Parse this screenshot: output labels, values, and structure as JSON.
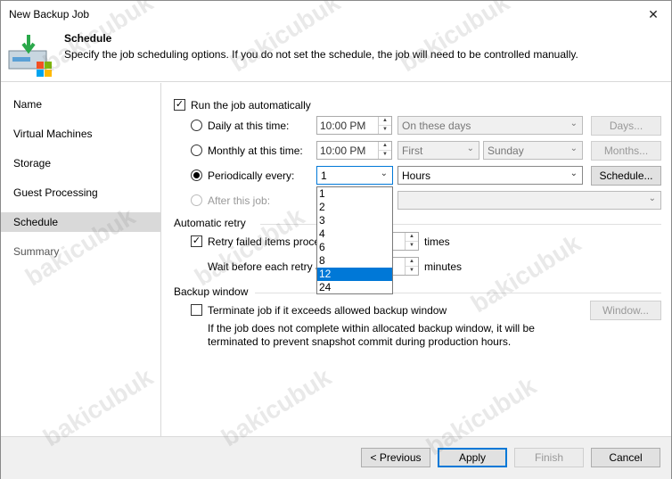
{
  "window": {
    "title": "New Backup Job",
    "close_icon": "close-icon"
  },
  "header": {
    "title": "Schedule",
    "description": "Specify the job scheduling options. If you do not set the schedule, the job will need to be controlled manually."
  },
  "sidebar": {
    "items": [
      {
        "label": "Name"
      },
      {
        "label": "Virtual Machines"
      },
      {
        "label": "Storage"
      },
      {
        "label": "Guest Processing"
      },
      {
        "label": "Schedule"
      },
      {
        "label": "Summary"
      }
    ],
    "active_index": 4
  },
  "schedule": {
    "run_automatically": {
      "label": "Run the job automatically",
      "checked": true
    },
    "daily": {
      "label": "Daily at this time:",
      "time": "10:00 PM",
      "days_combo": "On these days",
      "days_button": "Days..."
    },
    "monthly": {
      "label": "Monthly at this time:",
      "time": "10:00 PM",
      "week_combo": "First",
      "day_combo": "Sunday",
      "months_button": "Months..."
    },
    "periodically": {
      "label": "Periodically every:",
      "value": "1",
      "unit": "Hours",
      "schedule_button": "Schedule..."
    },
    "after_job": {
      "label": "After this job:"
    },
    "dropdown_options": [
      "1",
      "2",
      "3",
      "4",
      "6",
      "8",
      "12",
      "24"
    ],
    "dropdown_highlighted": "12"
  },
  "retry": {
    "section_title": "Automatic retry",
    "retry_label": "Retry failed items proce",
    "retry_unit": "times",
    "wait_label": "Wait before each retry a",
    "wait_unit": "minutes"
  },
  "backup_window": {
    "section_title": "Backup window",
    "terminate_label": "Terminate job if it exceeds allowed backup window",
    "note_line1": "If the job does not complete within allocated backup window, it will be",
    "note_line2": "terminated to prevent snapshot commit during production hours.",
    "window_button": "Window..."
  },
  "footer": {
    "previous": "< Previous",
    "apply": "Apply",
    "finish": "Finish",
    "cancel": "Cancel"
  },
  "watermark": "bakicubuk",
  "colors": {
    "accent": "#0078d7",
    "selected_sidebar": "#d9d9d9"
  }
}
